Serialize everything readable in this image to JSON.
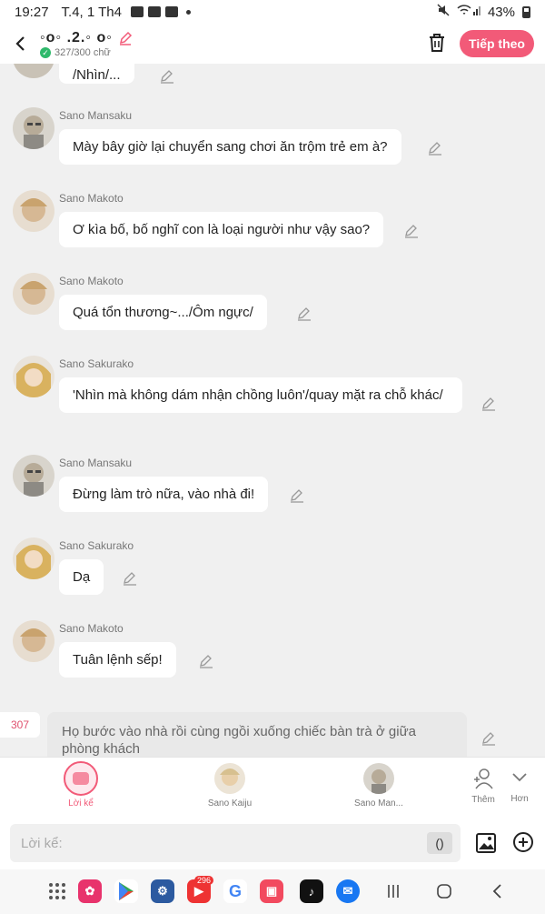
{
  "status_bar": {
    "time": "19:27",
    "date": "T.4, 1 Th4",
    "battery": "43%"
  },
  "header": {
    "title": "◦o◦ .2.◦ o◦",
    "char_count": "327/300 chữ",
    "next_label": "Tiếp theo"
  },
  "messages": [
    {
      "id": "m1",
      "text": "/Nhìn/..."
    },
    {
      "id": "m2",
      "name": "Sano Mansaku",
      "text": "Mày bây giờ lại chuyển sang chơi ăn trộm trẻ em à?"
    },
    {
      "id": "m3",
      "name": "Sano Makoto",
      "text": "Ơ kìa bố, bố nghĩ con là loại người như vậy sao?"
    },
    {
      "id": "m4",
      "name": "Sano Makoto",
      "text": "Quá tổn thương~.../Ôm ngực/"
    },
    {
      "id": "m5",
      "name": "Sano Sakurako",
      "text": "'Nhìn mà không dám nhận chồng luôn'/quay mặt ra chỗ khác/"
    },
    {
      "id": "m6",
      "name": "Sano Mansaku",
      "text": "Đừng làm trò nữa, vào nhà đi!"
    },
    {
      "id": "m7",
      "name": "Sano Sakurako",
      "text": "Dạ"
    },
    {
      "id": "m8",
      "name": "Sano Makoto",
      "text": "Tuân lệnh sếp!"
    }
  ],
  "narration": {
    "badge": "307",
    "text": "Họ bước vào nhà rồi cùng ngồi xuống chiếc bàn trà ở giữa phòng khách"
  },
  "char_bar": {
    "narrator": "Lời kể",
    "char1": "Sano Kaiju",
    "char2": "Sano Man...",
    "more": "Thêm",
    "less": "Hơn"
  },
  "input": {
    "placeholder": "Lời kể:",
    "paren": "()"
  },
  "nav": {
    "yt_badge": "296"
  },
  "colors": {
    "accent": "#f25a78",
    "bubble": "#ffffff",
    "background": "#f0f0f0"
  }
}
